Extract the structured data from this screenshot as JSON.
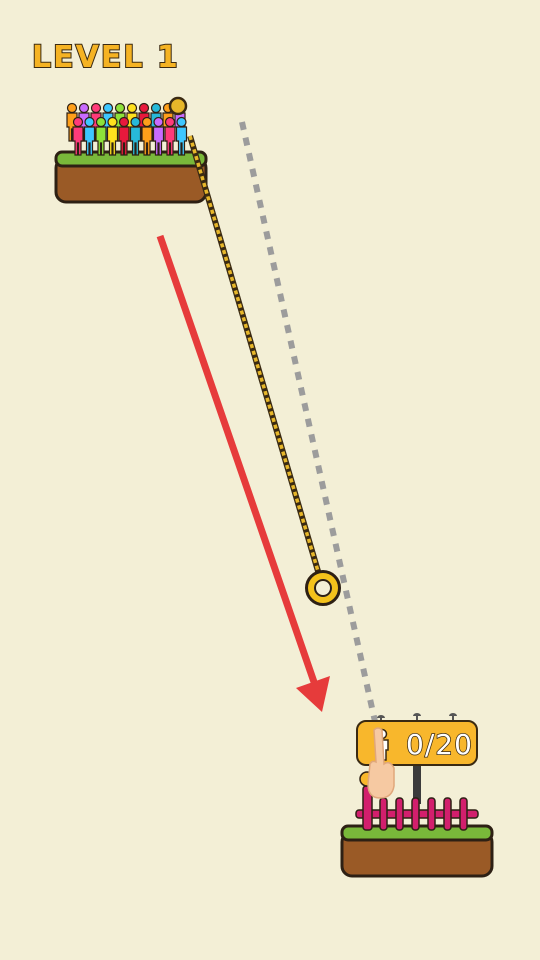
{
  "level": {
    "label": "LEVEL 1"
  },
  "goal": {
    "count_text": "0/20",
    "icon": "person-icon"
  },
  "crowd": {
    "colors": [
      "#ff9f1a",
      "#c86bff",
      "#ff3b7a",
      "#3ec7ff",
      "#8de23a",
      "#ffe11e",
      "#e8193c",
      "#27b9d9"
    ]
  },
  "hints": {
    "swipe_arrow_icon": "swipe-arrow-icon",
    "hand_icon": "pointing-hand-icon"
  },
  "colors": {
    "background": "#f3efd6",
    "grass": "#79b83a",
    "dirt": "#9a5a26",
    "rope": "#d9a61c",
    "arrow": "#e63b3b",
    "fence": "#d21f6d",
    "badge": "#f8b72c"
  }
}
